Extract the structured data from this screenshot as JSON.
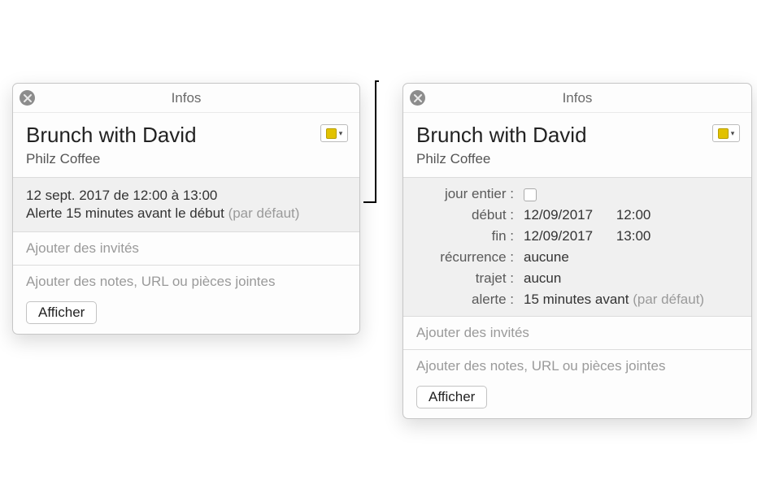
{
  "left": {
    "window_title": "Infos",
    "title": "Brunch with David",
    "location": "Philz Coffee",
    "summary_date": "12 sept. 2017  de 12:00 à 13:00",
    "summary_alert_text": "Alerte 15 minutes avant le début",
    "summary_alert_default": "(par défaut)",
    "invitees_placeholder": "Ajouter des invités",
    "notes_placeholder": "Ajouter des notes, URL ou pièces jointes",
    "show_button": "Afficher"
  },
  "right": {
    "window_title": "Infos",
    "title": "Brunch with David",
    "location": "Philz Coffee",
    "labels": {
      "all_day": "jour entier :",
      "start": "début :",
      "end": "fin :",
      "repeat": "récurrence :",
      "travel": "trajet :",
      "alert": "alerte :"
    },
    "values": {
      "all_day_checked": false,
      "start_date": "12/09/2017",
      "start_time": "12:00",
      "end_date": "12/09/2017",
      "end_time": "13:00",
      "repeat": "aucune",
      "travel": "aucun",
      "alert_text": "15 minutes avant",
      "alert_default": "(par défaut)"
    },
    "invitees_placeholder": "Ajouter des invités",
    "notes_placeholder": "Ajouter des notes, URL ou pièces jointes",
    "show_button": "Afficher"
  },
  "colors": {
    "calendar_color": "#e2c200"
  }
}
